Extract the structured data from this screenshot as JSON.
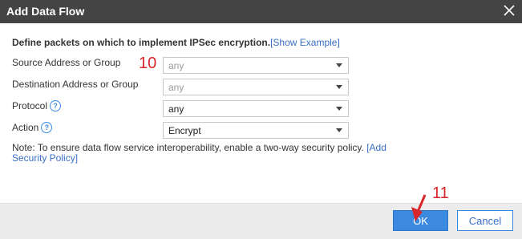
{
  "dialog": {
    "title": "Add Data Flow",
    "close_icon": "close-icon"
  },
  "heading": {
    "text": "Define packets on which to implement IPSec encryption.",
    "link": "[Show Example]"
  },
  "fields": {
    "source": {
      "label": "Source Address or Group",
      "value": "any",
      "state": "disabled"
    },
    "destination": {
      "label": "Destination Address or Group",
      "value": "any",
      "state": "disabled"
    },
    "protocol": {
      "label": "Protocol",
      "value": "any",
      "help_icon": "help-icon"
    },
    "action": {
      "label": "Action",
      "value": "Encrypt",
      "help_icon": "help-icon"
    }
  },
  "note": {
    "text": "Note: To ensure data flow service interoperability, enable a two-way security policy. ",
    "link": "[Add Security Policy]"
  },
  "buttons": {
    "ok": "OK",
    "cancel": "Cancel"
  },
  "annotations": {
    "step10": "10",
    "step11": "11",
    "color": "#d9262b"
  },
  "colors": {
    "titlebar": "#444444",
    "primary": "#3b8ae0",
    "link": "#3a6fc4",
    "footer": "#ececec"
  }
}
